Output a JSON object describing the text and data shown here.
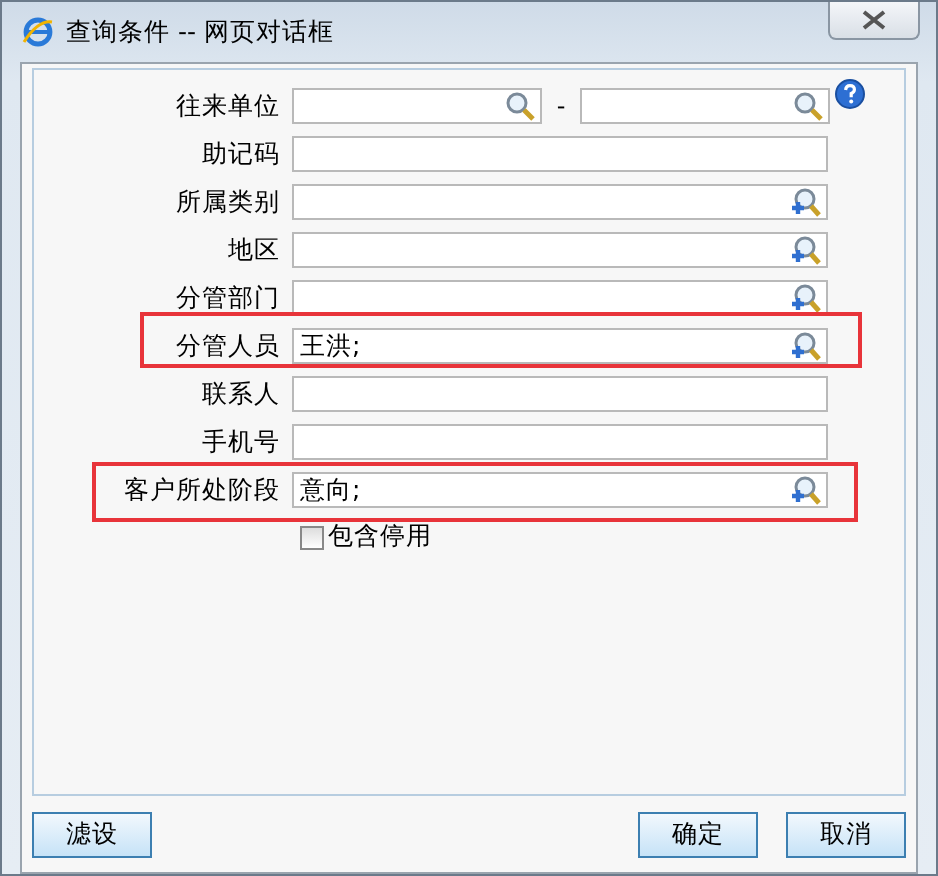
{
  "window": {
    "title": "查询条件 -- 网页对话框"
  },
  "rows": [
    {
      "label": "往来单位",
      "kind": "range",
      "separator": "-",
      "help": true,
      "highlighted": false
    },
    {
      "label": "助记码",
      "kind": "text",
      "highlighted": false
    },
    {
      "label": "所属类别",
      "kind": "picker",
      "highlighted": false
    },
    {
      "label": "地区",
      "kind": "picker",
      "highlighted": false
    },
    {
      "label": "分管部门",
      "kind": "picker",
      "highlighted": false
    },
    {
      "label": "分管人员",
      "kind": "picker",
      "value": "王洪;",
      "highlighted": true
    },
    {
      "label": "联系人",
      "kind": "text",
      "highlighted": false
    },
    {
      "label": "手机号",
      "kind": "text",
      "highlighted": false
    },
    {
      "label": "客户所处阶段",
      "kind": "picker",
      "value": "意向;",
      "highlighted": true
    }
  ],
  "include_disabled": {
    "label": "包含停用",
    "checked": false
  },
  "buttons": [
    {
      "label": "滤设",
      "kind": "left"
    },
    {
      "label": "确定",
      "kind": "right"
    },
    {
      "label": "取消",
      "kind": "right"
    }
  ]
}
